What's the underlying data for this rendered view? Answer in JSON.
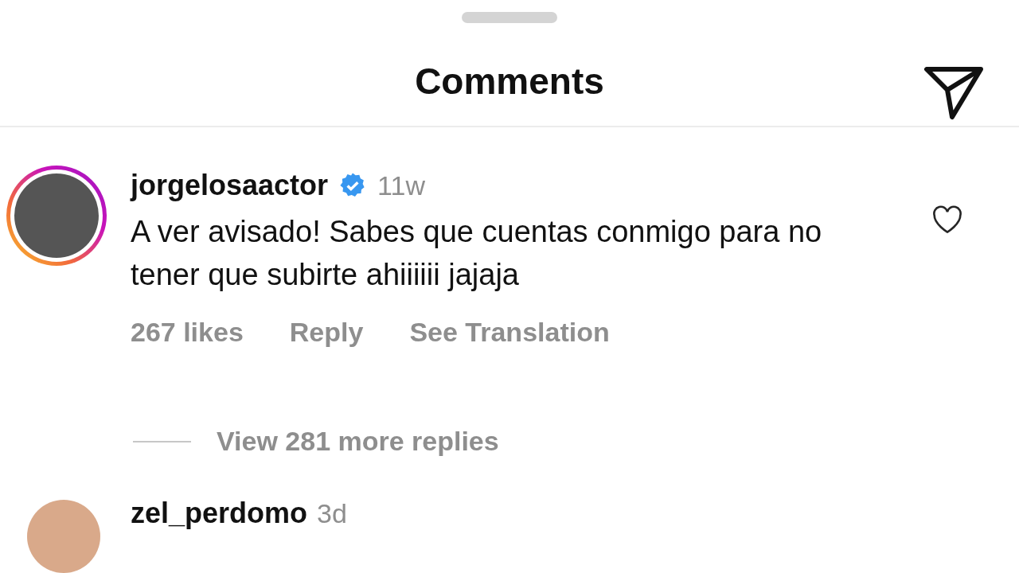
{
  "header": {
    "title": "Comments"
  },
  "comments": [
    {
      "username": "jorgelosaactor",
      "verified": true,
      "time": "11w",
      "text": "A ver avisado! Sabes que cuentas conmigo para no tener que subirte ahiiiiii jajaja",
      "likes": "267 likes",
      "reply": "Reply",
      "translation": "See Translation",
      "liked": false,
      "more_replies": "View 281 more replies"
    },
    {
      "username": "zel_perdomo",
      "verified": false,
      "time": "3d"
    }
  ]
}
